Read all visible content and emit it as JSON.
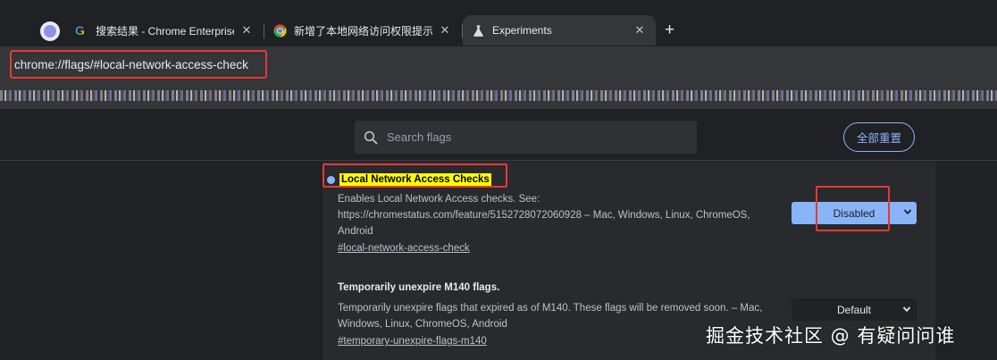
{
  "tabs": [
    {
      "title": "搜索结果 - Chrome Enterprise",
      "icon": "google-icon",
      "close": "✕"
    },
    {
      "title": "新增了本地网络访问权限提示",
      "icon": "chrome-icon",
      "close": "✕"
    },
    {
      "title": "Experiments",
      "icon": "flask-icon",
      "close": "✕",
      "active": true
    }
  ],
  "new_tab": "+",
  "address_bar": {
    "url": "chrome://flags/#local-network-access-check"
  },
  "search": {
    "placeholder": "Search flags"
  },
  "reset_button": {
    "label": "全部重置"
  },
  "experiments": [
    {
      "title": "Local Network Access Checks",
      "description": "Enables Local Network Access checks. See: https://chromestatus.com/feature/5152728072060928 – Mac, Windows, Linux, ChromeOS, Android",
      "link": "#local-network-access-check",
      "value": "Disabled"
    },
    {
      "title": "Temporarily unexpire M140 flags.",
      "description": "Temporarily unexpire flags that expired as of M140. These flags will be removed soon. – Mac, Windows, Linux, ChromeOS, Android",
      "link": "#temporary-unexpire-flags-m140",
      "value": "Default"
    }
  ],
  "watermark": "掘金技术社区 @ 有疑问问谁",
  "colors": {
    "accent": "#8ab4f8",
    "highlight": "#ffff00",
    "annotation": "#e53935"
  }
}
